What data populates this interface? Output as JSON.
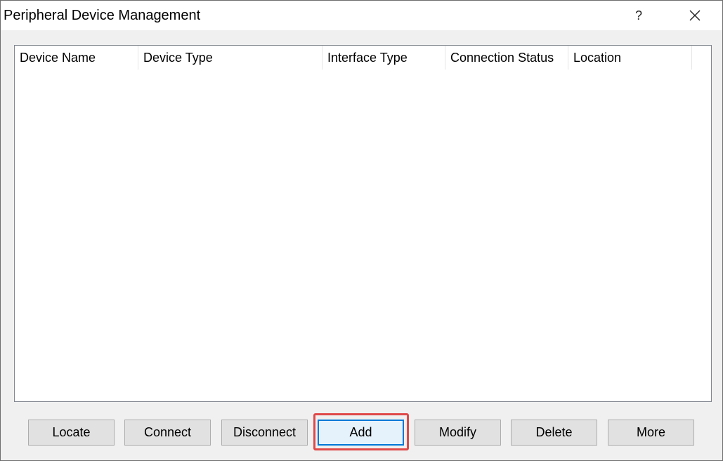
{
  "window": {
    "title": "Peripheral Device Management",
    "help_label": "?",
    "close_icon": "close-icon"
  },
  "list": {
    "columns": [
      "Device Name",
      "Device Type",
      "Interface Type",
      "Connection Status",
      "Location"
    ],
    "rows": []
  },
  "buttons": [
    {
      "label": "Locate"
    },
    {
      "label": "Connect"
    },
    {
      "label": "Disconnect"
    },
    {
      "label": "Add"
    },
    {
      "label": "Modify"
    },
    {
      "label": "Delete"
    },
    {
      "label": "More"
    }
  ],
  "focused_button": "Add",
  "colors": {
    "highlight": "#e04848",
    "focus": "#0078d7"
  }
}
